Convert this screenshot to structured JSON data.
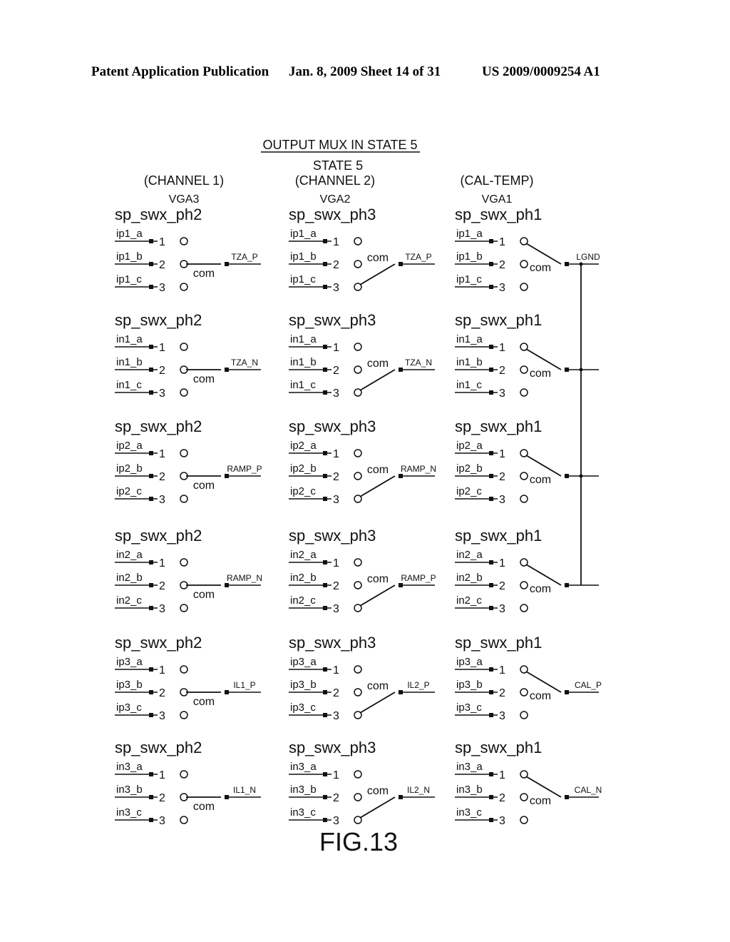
{
  "header": {
    "left": "Patent Application Publication",
    "date_sheet": "Jan. 8, 2009   Sheet 14 of 31",
    "publication_number": "US 2009/0009254 A1"
  },
  "diagram": {
    "title": "OUTPUT MUX IN STATE 5",
    "state_label": "STATE 5",
    "figure_label": "FIG.13",
    "com_label": "com",
    "columns": [
      {
        "channel": "(CHANNEL 1)",
        "vga": "VGA3",
        "switches": [
          {
            "name": "sp_swx_ph2",
            "inputs": [
              "ip1_a",
              "ip1_b",
              "ip1_c"
            ],
            "output": "TZA_P",
            "to": 2
          },
          {
            "name": "sp_swx_ph2",
            "inputs": [
              "in1_a",
              "in1_b",
              "in1_c"
            ],
            "output": "TZA_N",
            "to": 2
          },
          {
            "name": "sp_swx_ph2",
            "inputs": [
              "ip2_a",
              "ip2_b",
              "ip2_c"
            ],
            "output": "RAMP_P",
            "to": 2
          },
          {
            "name": "sp_swx_ph2",
            "inputs": [
              "in2_a",
              "in2_b",
              "in2_c"
            ],
            "output": "RAMP_N",
            "to": 2
          },
          {
            "name": "sp_swx_ph2",
            "inputs": [
              "ip3_a",
              "ip3_b",
              "ip3_c"
            ],
            "output": "IL1_P",
            "to": 2
          },
          {
            "name": "sp_swx_ph2",
            "inputs": [
              "in3_a",
              "in3_b",
              "in3_c"
            ],
            "output": "IL1_N",
            "to": 2
          }
        ]
      },
      {
        "channel": "(CHANNEL 2)",
        "vga": "VGA2",
        "switches": [
          {
            "name": "sp_swx_ph3",
            "inputs": [
              "ip1_a",
              "ip1_b",
              "ip1_c"
            ],
            "output": "TZA_P",
            "to": 3
          },
          {
            "name": "sp_swx_ph3",
            "inputs": [
              "in1_a",
              "in1_b",
              "in1_c"
            ],
            "output": "TZA_N",
            "to": 3
          },
          {
            "name": "sp_swx_ph3",
            "inputs": [
              "ip2_a",
              "ip2_b",
              "ip2_c"
            ],
            "output": "RAMP_N",
            "to": 3
          },
          {
            "name": "sp_swx_ph3",
            "inputs": [
              "in2_a",
              "in2_b",
              "in2_c"
            ],
            "output": "RAMP_P",
            "to": 3
          },
          {
            "name": "sp_swx_ph3",
            "inputs": [
              "ip3_a",
              "ip3_b",
              "ip3_c"
            ],
            "output": "IL2_P",
            "to": 3
          },
          {
            "name": "sp_swx_ph3",
            "inputs": [
              "in3_a",
              "in3_b",
              "in3_c"
            ],
            "output": "IL2_N",
            "to": 3
          }
        ]
      },
      {
        "channel": "(CAL-TEMP)",
        "vga": "VGA1",
        "switches": [
          {
            "name": "sp_swx_ph1",
            "inputs": [
              "ip1_a",
              "ip1_b",
              "ip1_c"
            ],
            "output": "LGND",
            "to": 1
          },
          {
            "name": "sp_swx_ph1",
            "inputs": [
              "in1_a",
              "in1_b",
              "in1_c"
            ],
            "output": "",
            "to": 1
          },
          {
            "name": "sp_swx_ph1",
            "inputs": [
              "ip2_a",
              "ip2_b",
              "ip2_c"
            ],
            "output": "",
            "to": 1
          },
          {
            "name": "sp_swx_ph1",
            "inputs": [
              "in2_a",
              "in2_b",
              "in2_c"
            ],
            "output": "",
            "to": 1
          },
          {
            "name": "sp_swx_ph1",
            "inputs": [
              "ip3_a",
              "ip3_b",
              "ip3_c"
            ],
            "output": "CAL_P",
            "to": 1
          },
          {
            "name": "sp_swx_ph1",
            "inputs": [
              "in3_a",
              "in3_b",
              "in3_c"
            ],
            "output": "CAL_N",
            "to": 1
          }
        ]
      }
    ],
    "pin_numbers": [
      "1",
      "2",
      "3"
    ]
  }
}
